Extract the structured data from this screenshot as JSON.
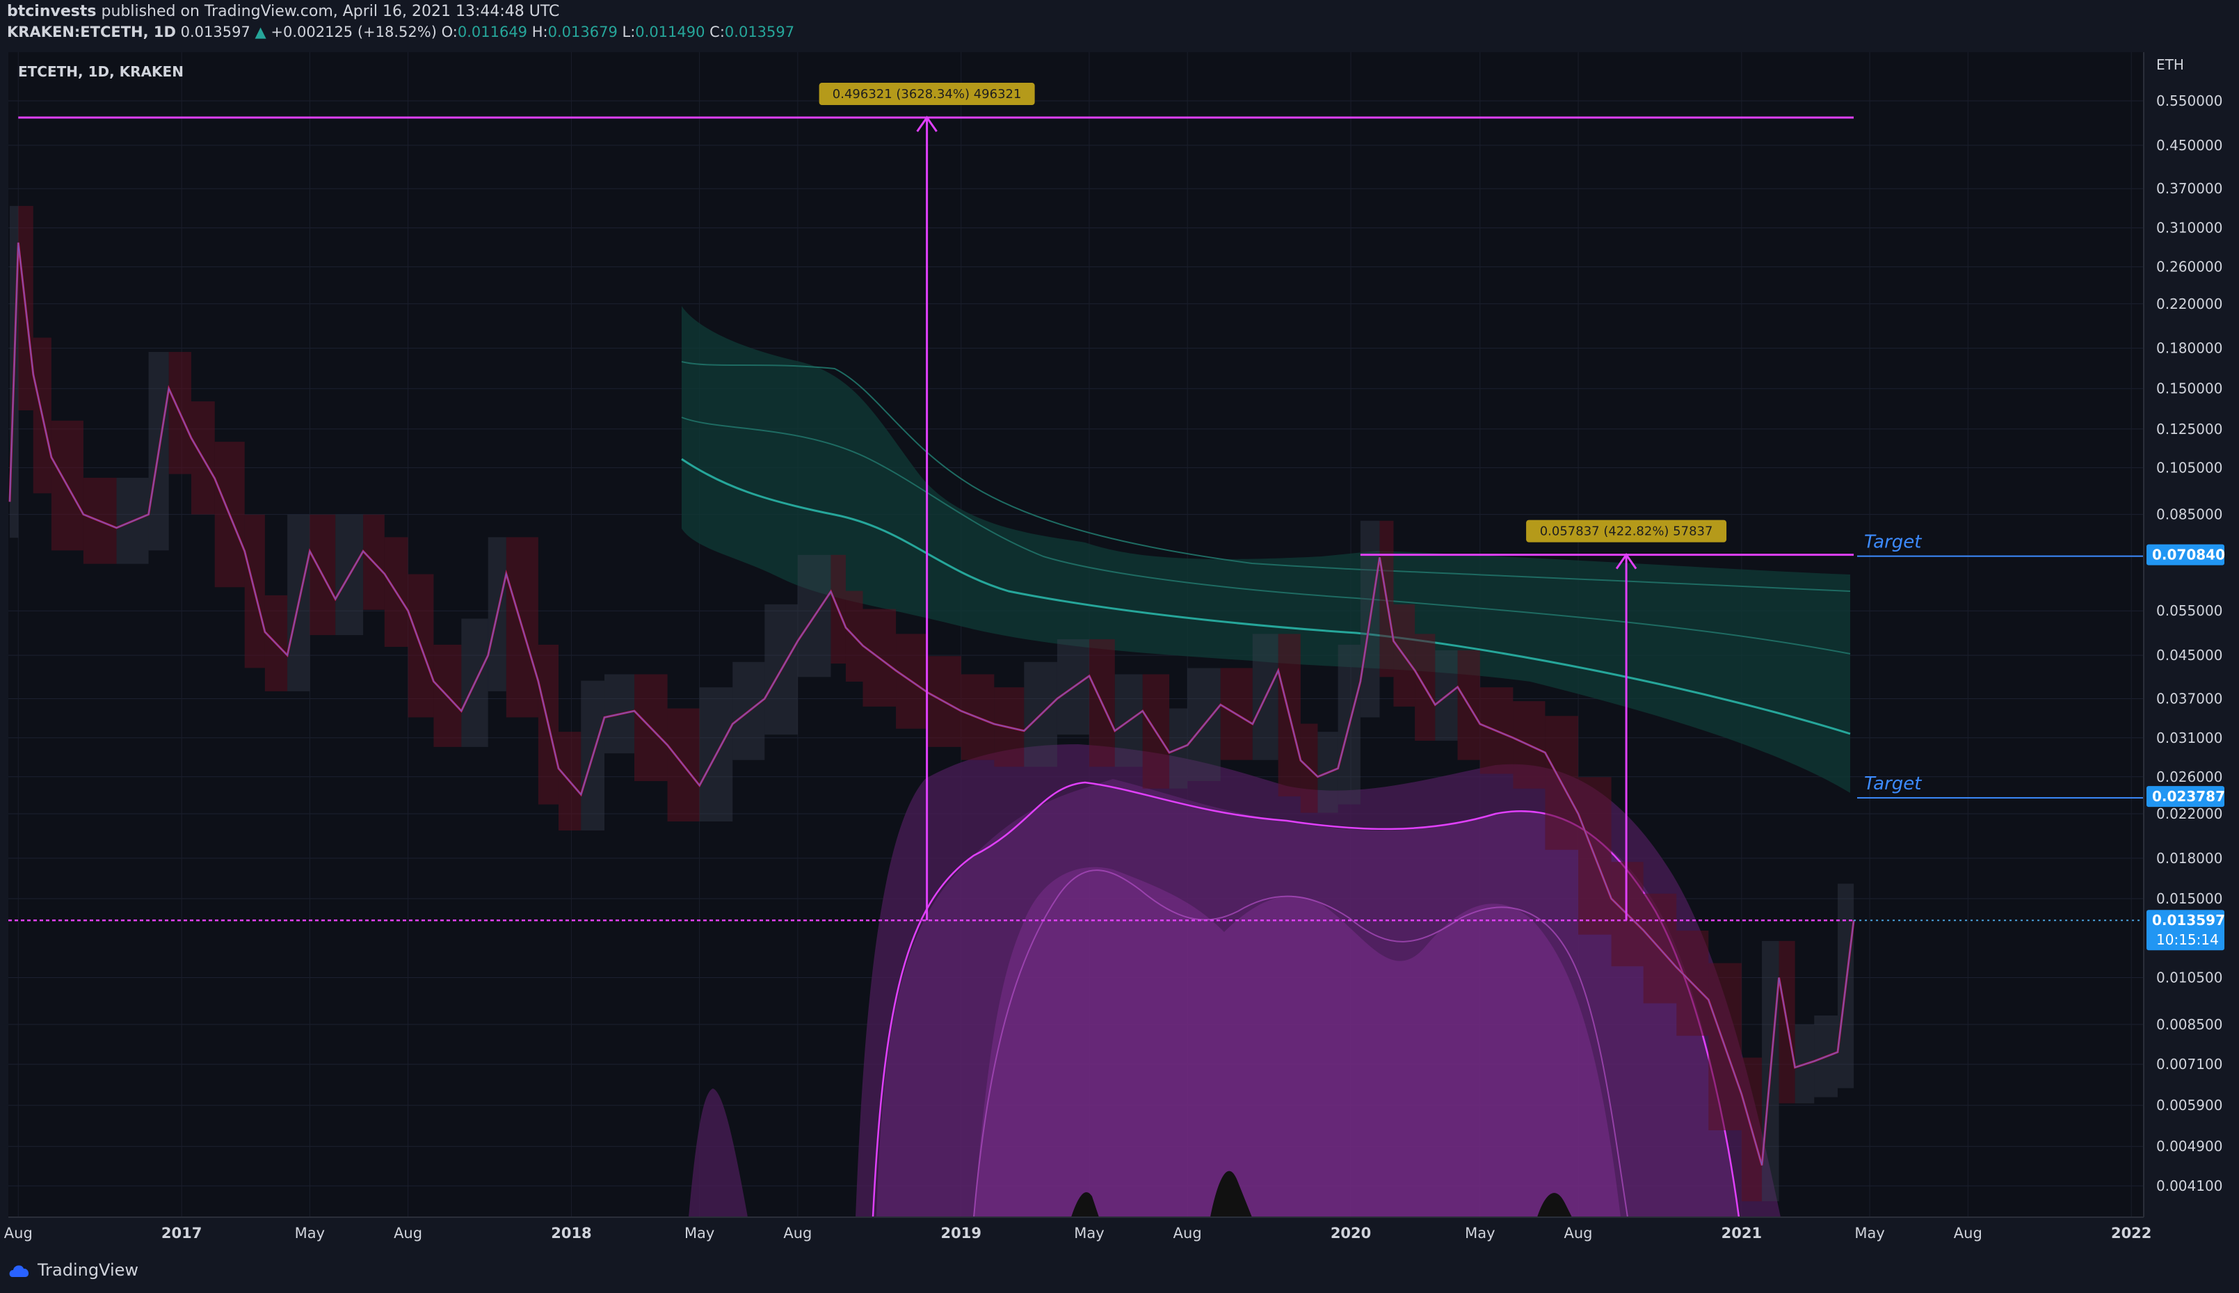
{
  "header": {
    "publisher": "btcinvests",
    "published_text": "published on TradingView.com, April 16, 2021 13:44:48 UTC",
    "symbol_line": "KRAKEN:ETCETH, 1D",
    "last": "0.013597",
    "change": "+0.002125 (+18.52%)",
    "o_label": "O:",
    "o_value": "0.011649",
    "h_label": "H:",
    "h_value": "0.013679",
    "l_label": "L:",
    "l_value": "0.011490",
    "c_label": "C:",
    "c_value": "0.013597"
  },
  "footer": {
    "brand": "TradingView"
  },
  "colors": {
    "background": "#131722",
    "magenta": "#e040fb",
    "teal": "#26a69a",
    "price_tag": "#2196f3",
    "measure_label_bg": "#b59a1a"
  },
  "chart_data": {
    "type": "line",
    "title": "ETCETH, 1D, KRAKEN",
    "y_unit": "ETH",
    "y_scale": "log",
    "ylim": [
      0.0037,
      0.66
    ],
    "x_ticks": [
      "Aug",
      "2017",
      "May",
      "Aug",
      "2018",
      "May",
      "Aug",
      "2019",
      "May",
      "Aug",
      "2020",
      "May",
      "Aug",
      "2021",
      "May",
      "Aug",
      "2022"
    ],
    "x_tick_dates": [
      "2016-08-01",
      "2017-01-01",
      "2017-05-01",
      "2017-08-01",
      "2018-01-01",
      "2018-05-01",
      "2018-08-01",
      "2019-01-01",
      "2019-05-01",
      "2019-08-01",
      "2020-01-01",
      "2020-05-01",
      "2020-08-01",
      "2021-01-01",
      "2021-05-01",
      "2021-08-01",
      "2022-01-01"
    ],
    "y_ticks": [
      "0.550000",
      "0.450000",
      "0.370000",
      "0.310000",
      "0.260000",
      "0.220000",
      "0.180000",
      "0.150000",
      "0.125000",
      "0.105000",
      "0.085000",
      "0.055000",
      "0.045000",
      "0.037000",
      "0.031000",
      "0.026000",
      "0.022000",
      "0.018000",
      "0.015000",
      "0.010500",
      "0.008500",
      "0.007100",
      "0.005900",
      "0.004900",
      "0.004100"
    ],
    "y_tick_values": [
      0.55,
      0.45,
      0.37,
      0.31,
      0.26,
      0.22,
      0.18,
      0.15,
      0.125,
      0.105,
      0.085,
      0.055,
      0.045,
      0.037,
      0.031,
      0.026,
      0.022,
      0.018,
      0.015,
      0.0105,
      0.0085,
      0.0071,
      0.0059,
      0.0049,
      0.0041
    ],
    "price_series": {
      "x": [
        "2016-07-24",
        "2016-08-01",
        "2016-08-15",
        "2016-09-01",
        "2016-10-01",
        "2016-11-01",
        "2016-12-01",
        "2016-12-20",
        "2017-01-10",
        "2017-02-01",
        "2017-03-01",
        "2017-03-20",
        "2017-04-10",
        "2017-05-01",
        "2017-05-25",
        "2017-06-20",
        "2017-07-10",
        "2017-08-01",
        "2017-08-25",
        "2017-09-20",
        "2017-10-15",
        "2017-11-01",
        "2017-12-01",
        "2017-12-20",
        "2018-01-10",
        "2018-02-01",
        "2018-03-01",
        "2018-04-01",
        "2018-05-01",
        "2018-06-01",
        "2018-07-01",
        "2018-08-01",
        "2018-09-01",
        "2018-09-15",
        "2018-10-01",
        "2018-11-01",
        "2018-12-01",
        "2019-01-01",
        "2019-02-01",
        "2019-03-01",
        "2019-04-01",
        "2019-05-01",
        "2019-05-25",
        "2019-06-20",
        "2019-07-15",
        "2019-08-01",
        "2019-09-01",
        "2019-10-01",
        "2019-10-25",
        "2019-11-15",
        "2019-12-01",
        "2019-12-20",
        "2020-01-10",
        "2020-01-28",
        "2020-02-10",
        "2020-03-01",
        "2020-03-20",
        "2020-04-10",
        "2020-05-01",
        "2020-06-01",
        "2020-07-01",
        "2020-08-01",
        "2020-09-01",
        "2020-10-01",
        "2020-11-01",
        "2020-12-01",
        "2021-01-01",
        "2021-01-20",
        "2021-02-05",
        "2021-02-20",
        "2021-03-10",
        "2021-04-01",
        "2021-04-16"
      ],
      "y": [
        0.09,
        0.29,
        0.16,
        0.11,
        0.085,
        0.08,
        0.085,
        0.15,
        0.12,
        0.1,
        0.072,
        0.05,
        0.045,
        0.072,
        0.058,
        0.072,
        0.065,
        0.055,
        0.04,
        0.035,
        0.045,
        0.065,
        0.04,
        0.027,
        0.024,
        0.034,
        0.035,
        0.03,
        0.025,
        0.033,
        0.037,
        0.048,
        0.06,
        0.051,
        0.047,
        0.042,
        0.038,
        0.035,
        0.033,
        0.032,
        0.037,
        0.041,
        0.032,
        0.035,
        0.029,
        0.03,
        0.036,
        0.033,
        0.042,
        0.028,
        0.026,
        0.027,
        0.04,
        0.07,
        0.048,
        0.042,
        0.036,
        0.039,
        0.033,
        0.031,
        0.029,
        0.022,
        0.015,
        0.013,
        0.011,
        0.0095,
        0.0062,
        0.0045,
        0.0105,
        0.007,
        0.0072,
        0.0075,
        0.013597
      ]
    },
    "measurements": [
      {
        "label": "0.496321 (3628.34%) 496321",
        "from_date": "2018-11-30",
        "from": 0.013597,
        "to": 0.51
      },
      {
        "label": "0.057837 (422.82%) 57837",
        "from_date": "2020-09-15",
        "from": 0.013597,
        "to": 0.07084
      }
    ],
    "horizontal_levels": [
      {
        "value": 0.51,
        "from_date": "2016-08-01",
        "to_date": "2021-04-16"
      },
      {
        "value": 0.07084,
        "from_date": "2020-01-10",
        "to_date": "2021-04-16"
      },
      {
        "value": 0.013597,
        "from_date": "2016-07-24",
        "to_date": "2021-04-16",
        "dashed": true
      }
    ],
    "targets": [
      {
        "label": "Target",
        "value": 0.07084,
        "price_tag": "0.070840"
      },
      {
        "label": "Target",
        "value": 0.023787,
        "price_tag": "0.023787"
      }
    ],
    "last_price_tag": "0.013597",
    "countdown": "10:15:14",
    "grid": true
  }
}
